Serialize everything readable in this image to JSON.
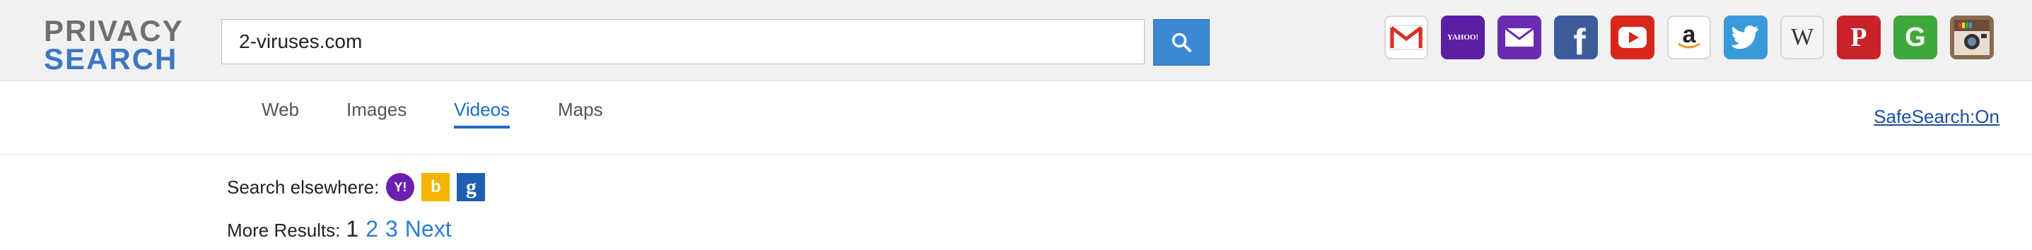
{
  "logo": {
    "line1": "PRIVACY",
    "line2": "SEARCH"
  },
  "search": {
    "value": "2-viruses.com",
    "button_icon": "search-icon"
  },
  "shortcuts": [
    {
      "name": "gmail",
      "icon": "gmail-icon",
      "color": "#ffffff"
    },
    {
      "name": "yahoo",
      "icon": "yahoo-icon",
      "color": "#5c1ea5",
      "text": "YAHOO!"
    },
    {
      "name": "yahoo-mail",
      "icon": "yahoo-mail-icon",
      "color": "#6a2bb3"
    },
    {
      "name": "facebook",
      "icon": "facebook-icon",
      "color": "#3b5b9a",
      "text": "f"
    },
    {
      "name": "youtube",
      "icon": "youtube-icon",
      "color": "#d9261c"
    },
    {
      "name": "amazon",
      "icon": "amazon-icon",
      "color": "#ffffff",
      "text": "a"
    },
    {
      "name": "twitter",
      "icon": "twitter-icon",
      "color": "#3a9ad9"
    },
    {
      "name": "wikipedia",
      "icon": "wikipedia-icon",
      "color": "#f4f4f4",
      "text": "W"
    },
    {
      "name": "pinterest",
      "icon": "pinterest-icon",
      "color": "#c9222a",
      "text": "P"
    },
    {
      "name": "grammarly",
      "icon": "grammarly-icon",
      "color": "#3ea83a",
      "text": "G"
    },
    {
      "name": "instagram",
      "icon": "instagram-icon",
      "color": "#8b6a4f"
    }
  ],
  "tabs": [
    {
      "label": "Web",
      "active": false
    },
    {
      "label": "Images",
      "active": false
    },
    {
      "label": "Videos",
      "active": true
    },
    {
      "label": "Maps",
      "active": false
    }
  ],
  "safesearch": "SafeSearch:On",
  "elsewhere": {
    "label": "Search elsewhere:",
    "engines": [
      {
        "icon": "yahoo-icon",
        "color": "#6a1fb0",
        "text": "Y!"
      },
      {
        "icon": "bing-icon",
        "color": "#f5b400",
        "text": "b"
      },
      {
        "icon": "google-icon",
        "color": "#1f5fb0",
        "text": "g"
      }
    ]
  },
  "more_results": {
    "label": "More Results:",
    "pages": [
      "1",
      "2",
      "3",
      "Next"
    ],
    "current": "1"
  }
}
